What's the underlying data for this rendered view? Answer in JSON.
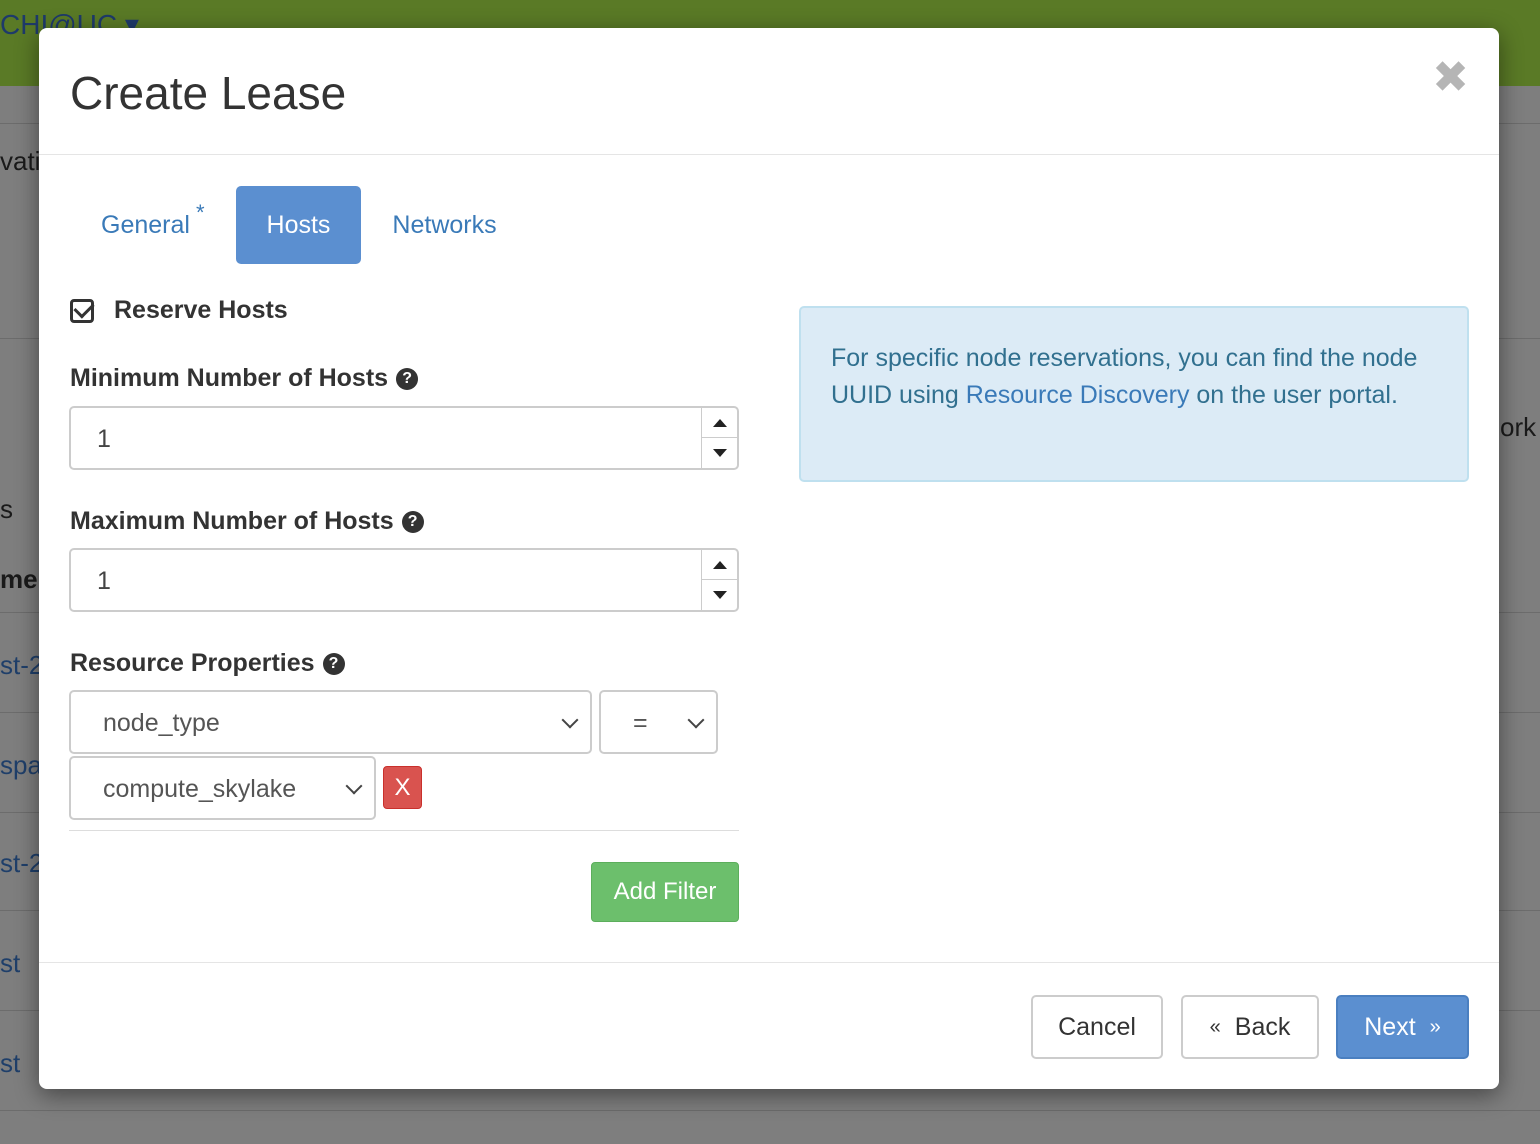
{
  "background": {
    "brand": "CHI@UC",
    "fragments": [
      "vati",
      "s",
      "me",
      "st-2",
      "spa",
      "st-2",
      "st",
      "st",
      "ork"
    ]
  },
  "modal": {
    "title": "Create Lease",
    "close_glyph": "✖"
  },
  "tabs": [
    {
      "label": "General",
      "required_mark": "*"
    },
    {
      "label": "Hosts"
    },
    {
      "label": "Networks"
    }
  ],
  "form": {
    "reserve_hosts_label": "Reserve Hosts",
    "min_hosts": {
      "label": "Minimum Number of Hosts",
      "value": "1"
    },
    "max_hosts": {
      "label": "Maximum Number of Hosts",
      "value": "1"
    },
    "resource_properties": {
      "label": "Resource Properties",
      "property": "node_type",
      "operator": "=",
      "value": "compute_skylake",
      "remove_label": "X"
    },
    "add_filter_label": "Add Filter"
  },
  "info": {
    "text_before": "For specific node reservations, you can find the node UUID using ",
    "link": "Resource Discovery",
    "text_after": " on the user portal."
  },
  "footer": {
    "cancel_label": "Cancel",
    "back_label": "Back",
    "back_glyph": "«",
    "next_label": "Next",
    "next_glyph": "»"
  },
  "colors": {
    "primary": "#5b8fd0",
    "success": "#6cbf6c",
    "danger": "#d9534f",
    "info_bg": "#dcebf6"
  }
}
